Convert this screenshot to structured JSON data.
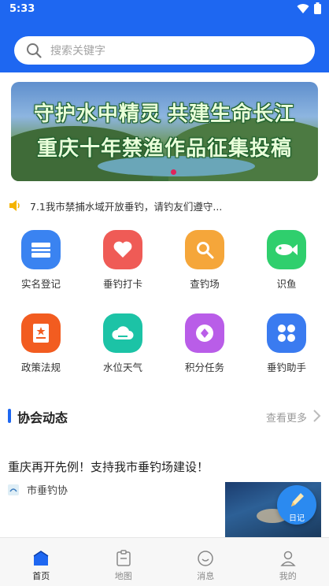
{
  "status": {
    "time": "5:33"
  },
  "search": {
    "placeholder": "搜索关键字"
  },
  "banner": {
    "line1": "守护水中精灵 共建生命长江",
    "line2": "重庆十年禁渔作品征集投稿"
  },
  "notice": {
    "text": "7.1我市禁捕水域开放垂钓，请钓友们遵守..."
  },
  "grid": [
    {
      "label": "实名登记",
      "icon": "id-card-icon",
      "color": "#3a83f1"
    },
    {
      "label": "垂钓打卡",
      "icon": "heart-icon",
      "color": "#ef5b56"
    },
    {
      "label": "查钓场",
      "icon": "search-icon",
      "color": "#f5a63a"
    },
    {
      "label": "识鱼",
      "icon": "fish-icon",
      "color": "#2fcf6d"
    },
    {
      "label": "政策法规",
      "icon": "document-icon",
      "color": "#f25c20"
    },
    {
      "label": "水位天气",
      "icon": "cloud-icon",
      "color": "#1cc3a6"
    },
    {
      "label": "积分任务",
      "icon": "points-icon",
      "color": "#b95de8"
    },
    {
      "label": "垂钓助手",
      "icon": "apps-icon",
      "color": "#3a7bf0"
    }
  ],
  "section": {
    "title": "协会动态",
    "more": "查看更多"
  },
  "news": {
    "title": "重庆再开先例！支持我市垂钓场建设！",
    "source": "市垂钓协"
  },
  "diary": {
    "label": "日记"
  },
  "tabs": [
    {
      "label": "首页",
      "icon": "home-icon"
    },
    {
      "label": "地图",
      "icon": "map-icon"
    },
    {
      "label": "消息",
      "icon": "message-icon"
    },
    {
      "label": "我的",
      "icon": "profile-icon"
    }
  ],
  "colors": {
    "primary": "#1e67f1",
    "accent_dot": "#e0245a"
  }
}
